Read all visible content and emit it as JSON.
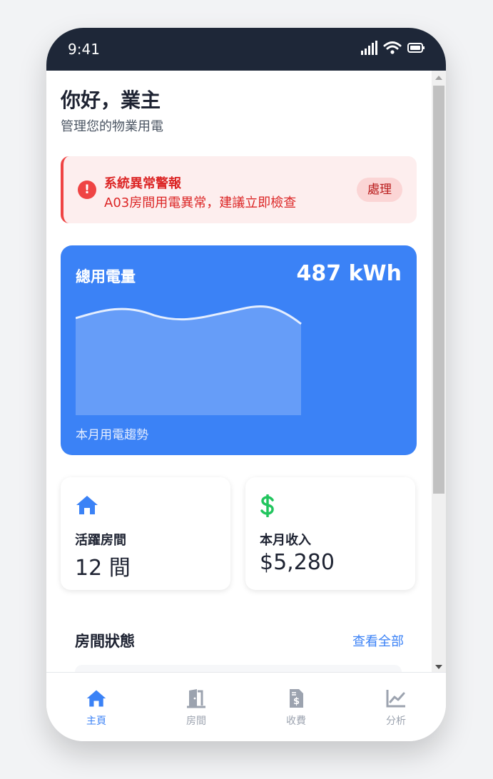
{
  "status_bar": {
    "time": "9:41"
  },
  "header": {
    "greeting": "你好，業主",
    "subtitle": "管理您的物業用電"
  },
  "alert": {
    "title": "系統異常警報",
    "message": "A03房間用電異常，建議立即檢查",
    "action_label": "處理",
    "icon": "exclamation-circle-icon",
    "color": "#ef4444"
  },
  "usage": {
    "title": "總用電量",
    "value": "487 kWh",
    "caption": "本月用電趨勢",
    "color": "#3b82f6"
  },
  "stats": [
    {
      "icon": "home-icon",
      "label": "活躍房間",
      "value": "12 間",
      "icon_color": "#3b82f6"
    },
    {
      "icon": "dollar-icon",
      "label": "本月收入",
      "value": "$5,280",
      "icon_color": "#22c55e"
    }
  ],
  "rooms_section": {
    "title": "房間狀態",
    "link": "查看全部"
  },
  "bottom_nav": [
    {
      "label": "主頁",
      "icon": "home-icon",
      "active": true
    },
    {
      "label": "房間",
      "icon": "door-icon",
      "active": false
    },
    {
      "label": "收費",
      "icon": "invoice-icon",
      "active": false
    },
    {
      "label": "分析",
      "icon": "chart-line-icon",
      "active": false
    }
  ]
}
